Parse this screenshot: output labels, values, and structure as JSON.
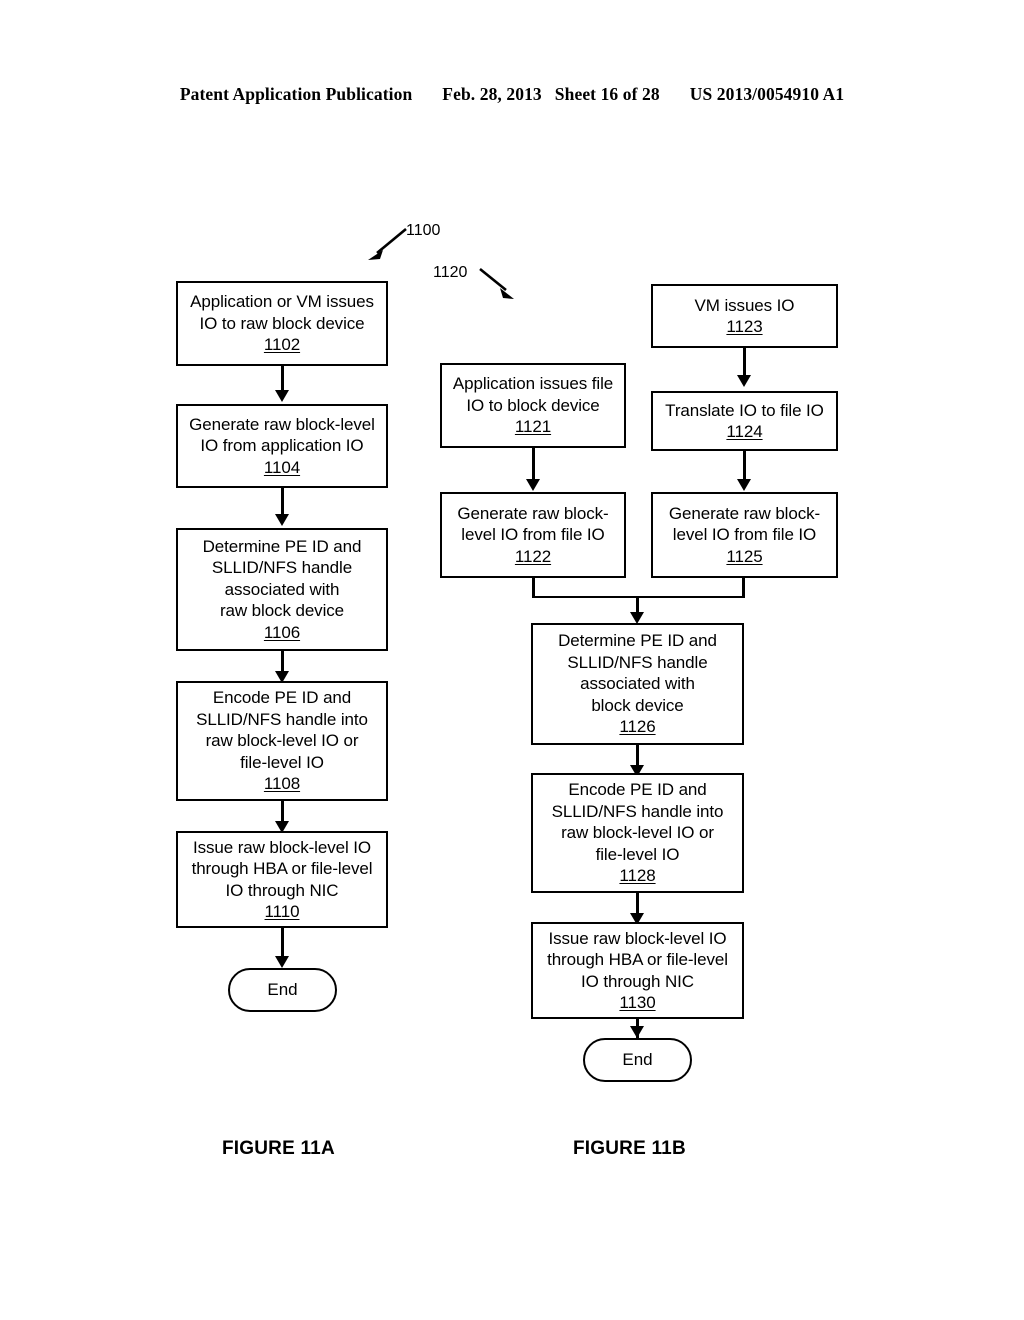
{
  "header": {
    "publication": "Patent Application Publication",
    "date": "Feb. 28, 2013",
    "sheet": "Sheet 16 of 28",
    "patent_number": "US 2013/0054910 A1"
  },
  "figures": [
    {
      "caption": "FIGURE 11A",
      "diagram_ref": "1100"
    },
    {
      "caption": "FIGURE 11B",
      "diagram_ref": "1120"
    }
  ],
  "flowchart_a": {
    "ref": "1100",
    "nodes": [
      {
        "id": "n1102",
        "text": "Application or VM issues\nIO to raw block device",
        "ref": "1102",
        "shape": "process"
      },
      {
        "id": "n1104",
        "text": "Generate raw block-level\nIO from application IO",
        "ref": "1104",
        "shape": "process"
      },
      {
        "id": "n1106",
        "text": "Determine PE ID and\nSLLID/NFS handle\nassociated with\nraw block device",
        "ref": "1106",
        "shape": "process"
      },
      {
        "id": "n1108",
        "text": "Encode PE ID and\nSLLID/NFS handle into\nraw block-level IO or\nfile-level IO",
        "ref": "1108",
        "shape": "process"
      },
      {
        "id": "n1110",
        "text": "Issue raw block-level IO\nthrough HBA or file-level\nIO through NIC",
        "ref": "1110",
        "shape": "process"
      },
      {
        "id": "nEndA",
        "text": "End",
        "ref": "",
        "shape": "terminator"
      }
    ]
  },
  "flowchart_b": {
    "ref": "1120",
    "nodes": [
      {
        "id": "n1121",
        "text": "Application issues file\nIO to block device",
        "ref": "1121",
        "shape": "process"
      },
      {
        "id": "n1123",
        "text": "VM issues IO",
        "ref": "1123",
        "shape": "process"
      },
      {
        "id": "n1124",
        "text": "Translate IO to file IO",
        "ref": "1124",
        "shape": "process"
      },
      {
        "id": "n1122",
        "text": "Generate raw block-\nlevel IO from file IO",
        "ref": "1122",
        "shape": "process"
      },
      {
        "id": "n1125",
        "text": "Generate raw block-\nlevel IO from file IO",
        "ref": "1125",
        "shape": "process"
      },
      {
        "id": "n1126",
        "text": "Determine PE ID and\nSLLID/NFS handle\nassociated with\nblock device",
        "ref": "1126",
        "shape": "process"
      },
      {
        "id": "n1128",
        "text": "Encode PE ID and\nSLLID/NFS handle into\nraw block-level IO or\nfile-level IO",
        "ref": "1128",
        "shape": "process"
      },
      {
        "id": "n1130",
        "text": "Issue raw block-level IO\nthrough HBA or file-level\nIO through NIC",
        "ref": "1130",
        "shape": "process"
      },
      {
        "id": "nEndB",
        "text": "End",
        "ref": "",
        "shape": "terminator"
      }
    ]
  },
  "colors": {
    "ink": "#000000",
    "paper": "#ffffff"
  }
}
